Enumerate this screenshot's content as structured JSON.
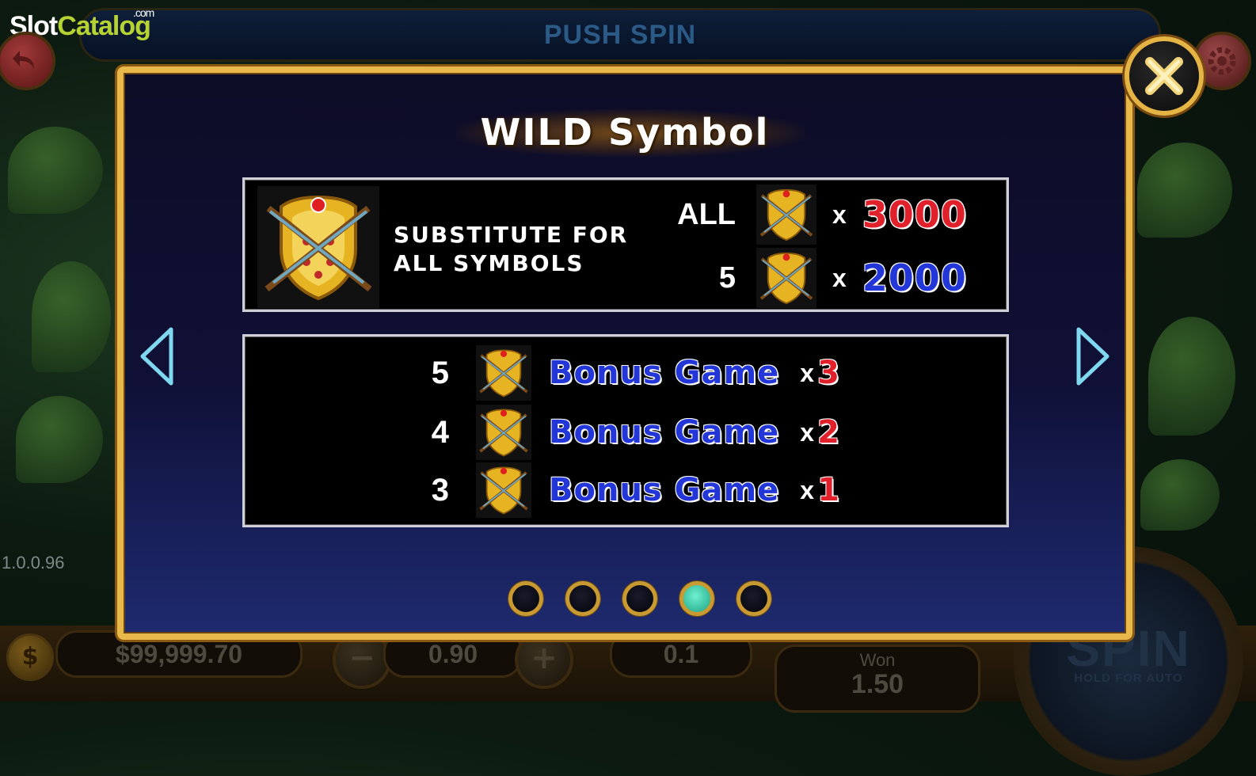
{
  "brand": {
    "name_part1": "Slot",
    "name_part2": "Catalog",
    "suffix": ".com"
  },
  "top_bar": {
    "title": "PUSH SPIN"
  },
  "version": "1.0.0.96",
  "bottom_bar": {
    "balance": "$99,999.70",
    "bet": "0.90",
    "lines": "0.1",
    "won_label": "Won",
    "won_value": "1.50",
    "spin_label": "SPIN",
    "spin_sublabel": "HOLD FOR AUTO"
  },
  "modal": {
    "title": "WILD Symbol",
    "substitute_text_line1": "SUBSTITUTE FOR",
    "substitute_text_line2": "ALL SYMBOLS",
    "payouts": [
      {
        "count": "ALL",
        "x": "x",
        "value": "3000",
        "color": "#e0202a"
      },
      {
        "count": "5",
        "x": "x",
        "value": "2000",
        "color": "#2336d8"
      }
    ],
    "bonus_rows": [
      {
        "count": "5",
        "label": "Bonus Game",
        "x": "x",
        "mult": "3"
      },
      {
        "count": "4",
        "label": "Bonus Game",
        "x": "x",
        "mult": "2"
      },
      {
        "count": "3",
        "label": "Bonus Game",
        "x": "x",
        "mult": "1"
      }
    ],
    "pagination": {
      "total": 5,
      "active_index": 3
    }
  },
  "icons": {
    "back": "back-arrow-icon",
    "settings": "gear-icon",
    "close": "close-icon",
    "prev": "chevron-left-icon",
    "next": "chevron-right-icon",
    "wild": "wild-shield-crossed-rifles-icon",
    "coin": "coin-dollar-icon"
  },
  "colors": {
    "modal_border": "#e8b84a",
    "payout_red": "#e0202a",
    "payout_blue": "#2336d8",
    "dot_active": "#3fd3ae"
  }
}
